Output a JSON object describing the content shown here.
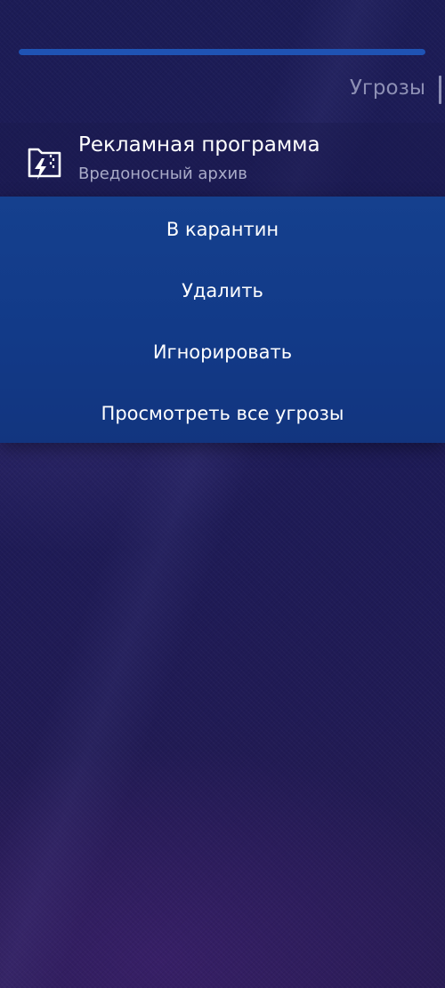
{
  "progress": {
    "value_percent": 100
  },
  "tab": {
    "label": "Угрозы"
  },
  "threat": {
    "title": "Рекламная программа",
    "subtitle": "Вредоносный архив",
    "icon": "archive-folder-lightning-icon"
  },
  "menu": {
    "items": [
      {
        "label": "В карантин"
      },
      {
        "label": "Удалить"
      },
      {
        "label": "Игнорировать"
      },
      {
        "label": "Просмотреть все угрозы"
      }
    ]
  },
  "colors": {
    "background": "#1d1a52",
    "menu_background": "#163d8b",
    "progress_track": "#0d2b78",
    "progress_fill": "#1f53b4",
    "muted_text": "#8d8fb4",
    "subtitle_text": "#a9abc8"
  }
}
